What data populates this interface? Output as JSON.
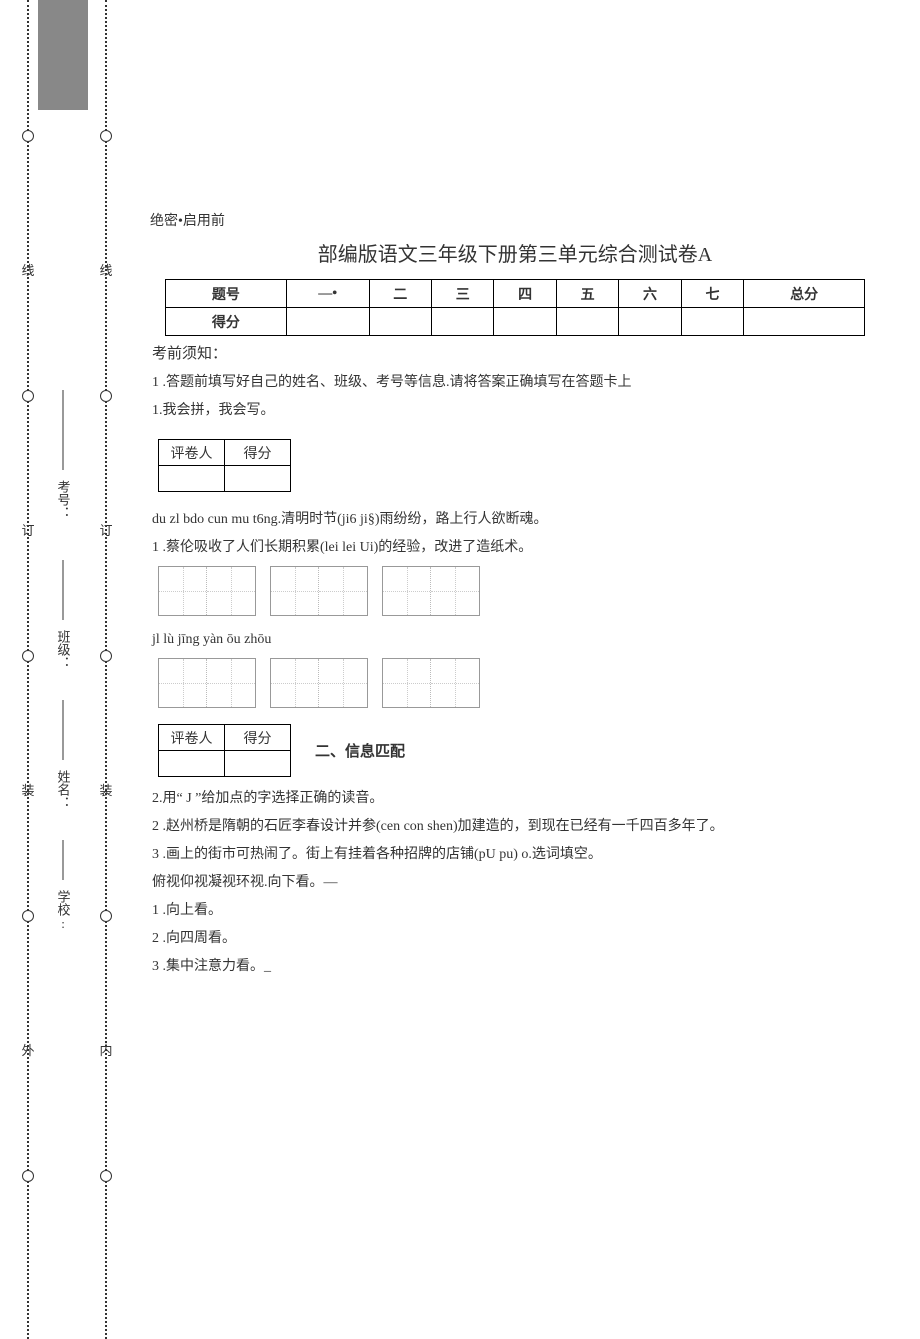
{
  "margin": {
    "outer_chars": [
      "线",
      "订",
      "装",
      "外"
    ],
    "inner_chars": [
      "线",
      "订",
      "装",
      "内"
    ],
    "fields": {
      "exam_no": "考号：",
      "class": "班级：",
      "name": "姓名：",
      "school": "学校:"
    }
  },
  "doc": {
    "secret": "绝密•启用前",
    "title": "部编版语文三年级下册第三单元综合测试卷A",
    "score_headers": [
      "题号",
      "—•",
      "二",
      "三",
      "四",
      "五",
      "六",
      "七",
      "总分"
    ],
    "score_row_label": "得分",
    "instruction_head": "考前须知：",
    "instruction1": "1 .答题前填写好自己的姓名、班级、考号等信息.请将答案正确填写在答题卡上",
    "section1": "1.我会拼，我会写。",
    "grader_label1": "评卷人",
    "grader_label2": "得分",
    "q_pinyin1a": "du zl bdo cun mu t6ng.清明时节(ji6 ji§)雨纷纷，路上行人欲断魂。",
    "q1_line": "1 .蔡伦吸收了人们长期积累(lei lei Ui)的经验，改进了造纸术。",
    "pinyin_row2": "jl lù jīng yàn ōu zhōu",
    "section2": "二、信息匹配",
    "q2_intro": "2.用“ J ”给加点的字选择正确的读音。",
    "q2_line2": "2 .赵州桥是隋朝的石匠李春设计并参(cen con shen)加建造的，到现在已经有一千四百多年了。",
    "q2_line3": "3 .画上的街市可热闹了。街上有挂着各种招牌的店铺(pU pu) o.选词填空。",
    "q_words": "俯视仰视凝视环视.向下看。—",
    "opt1": "1 .向上看。",
    "opt2": "2 .向四周看。",
    "opt3": "3 .集中注意力看。_"
  }
}
